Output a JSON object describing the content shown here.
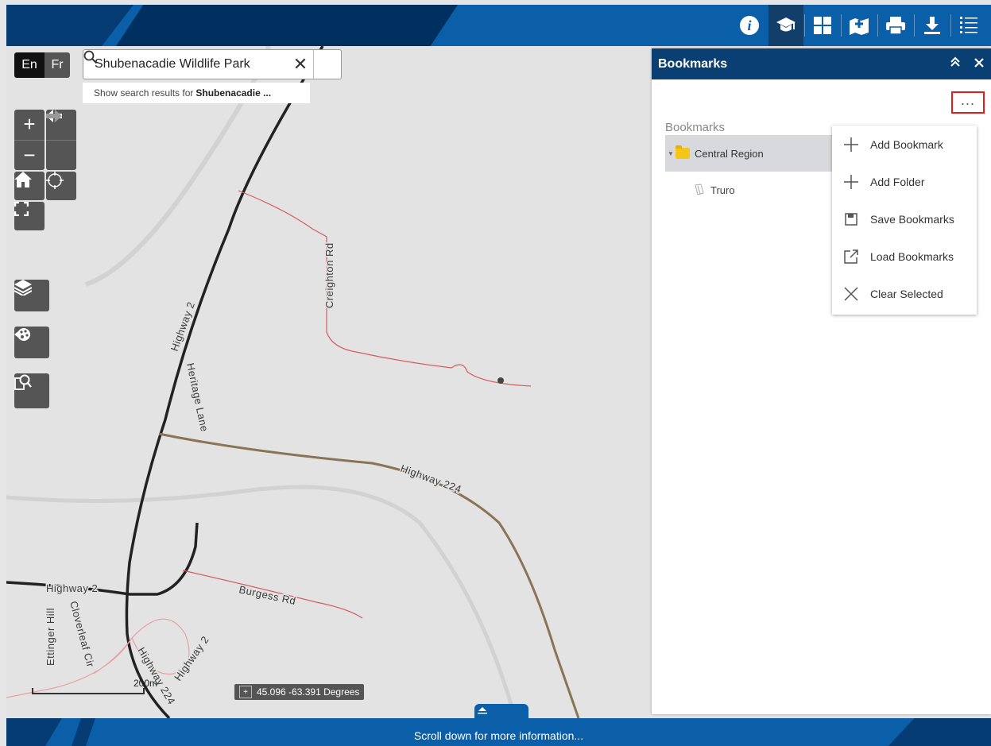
{
  "header": {
    "buttons": [
      {
        "name": "info-icon"
      },
      {
        "name": "learning-icon",
        "active": true
      },
      {
        "name": "grid-icon"
      },
      {
        "name": "add-to-map-icon"
      },
      {
        "name": "print-icon"
      },
      {
        "name": "download-icon"
      },
      {
        "name": "list-icon"
      }
    ]
  },
  "language": {
    "en": "En",
    "fr": "Fr"
  },
  "search": {
    "value": "Shubenacadie Wildlife Park",
    "suggestion_prefix": "Show search results for",
    "suggestion_term": "Shubenacadie ..."
  },
  "map": {
    "roads": [
      "Highway 2",
      "Heritage Lane",
      "Creighton Rd",
      "Highway 224",
      "Burgess Rd",
      "Ettinger Hill",
      "Cloverleaf Cir",
      "Highway 2",
      "Highway 224",
      "Highway 2"
    ],
    "scale": "200m",
    "coordinates": "45.096 -63.391 Degrees"
  },
  "panel": {
    "title": "Bookmarks",
    "section_label": "Bookmarks",
    "folder": "Central Region",
    "item": "Truro",
    "menu": [
      {
        "label": "Add Bookmark",
        "icon": "plus-icon"
      },
      {
        "label": "Add Folder",
        "icon": "plus-icon"
      },
      {
        "label": "Save Bookmarks",
        "icon": "save-icon"
      },
      {
        "label": "Load Bookmarks",
        "icon": "external-link-icon"
      },
      {
        "label": "Clear Selected",
        "icon": "close-icon"
      }
    ]
  },
  "footer": {
    "text": "Scroll down for more information..."
  },
  "colors": {
    "header": "#0b5ea8",
    "panel_header": "#0a3f73",
    "highlight": "#e31b1b"
  }
}
